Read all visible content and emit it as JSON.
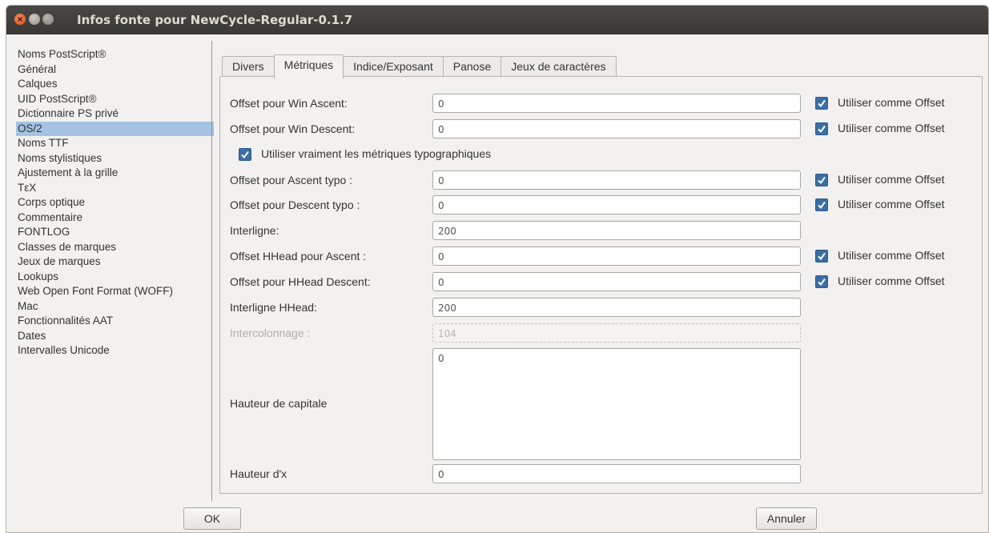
{
  "window": {
    "title": "Infos fonte pour NewCycle-Regular-0.1.7"
  },
  "sidebar": {
    "items": [
      {
        "label": "Noms PostScript®",
        "selected": false
      },
      {
        "label": "Général",
        "selected": false
      },
      {
        "label": "Calques",
        "selected": false
      },
      {
        "label": "UID PostScript®",
        "selected": false
      },
      {
        "label": "Dictionnaire PS privé",
        "selected": false
      },
      {
        "label": "OS/2",
        "selected": true
      },
      {
        "label": "Noms TTF",
        "selected": false
      },
      {
        "label": "Noms stylistiques",
        "selected": false
      },
      {
        "label": "Ajustement à la grille",
        "selected": false
      },
      {
        "label": "TεX",
        "selected": false
      },
      {
        "label": "Corps optique",
        "selected": false
      },
      {
        "label": "Commentaire",
        "selected": false
      },
      {
        "label": "FONTLOG",
        "selected": false
      },
      {
        "label": "Classes de marques",
        "selected": false
      },
      {
        "label": "Jeux de marques",
        "selected": false
      },
      {
        "label": "Lookups",
        "selected": false
      },
      {
        "label": "Web Open Font Format (WOFF)",
        "selected": false
      },
      {
        "label": "Mac",
        "selected": false
      },
      {
        "label": "Fonctionnalités AAT",
        "selected": false
      },
      {
        "label": "Dates",
        "selected": false
      },
      {
        "label": "Intervalles Unicode",
        "selected": false
      }
    ]
  },
  "tabs": [
    {
      "label": "Divers",
      "active": false
    },
    {
      "label": "Métriques",
      "active": true
    },
    {
      "label": "Indice/Exposant",
      "active": false
    },
    {
      "label": "Panose",
      "active": false
    },
    {
      "label": "Jeux de caractères",
      "active": false
    }
  ],
  "metrics": {
    "win_ascent": {
      "label": "Offset pour Win Ascent:",
      "value": "0",
      "offset_label": "Utiliser comme Offset",
      "offset_checked": true
    },
    "win_descent": {
      "label": "Offset pour Win Descent:",
      "value": "0",
      "offset_label": "Utiliser comme Offset",
      "offset_checked": true
    },
    "typo_metrics": {
      "label": "Utiliser vraiment les métriques typographiques",
      "checked": true
    },
    "typo_ascent": {
      "label": "Offset pour Ascent typo :",
      "value": "0",
      "offset_label": "Utiliser comme Offset",
      "offset_checked": true
    },
    "typo_descent": {
      "label": "Offset pour Descent typo :",
      "value": "0",
      "offset_label": "Utiliser comme Offset",
      "offset_checked": true
    },
    "line_gap": {
      "label": "Interligne:",
      "value": "200"
    },
    "hhead_ascent": {
      "label": "Offset HHead pour Ascent :",
      "value": "0",
      "offset_label": "Utiliser comme Offset",
      "offset_checked": true
    },
    "hhead_descent": {
      "label": "Offset pour HHead Descent:",
      "value": "0",
      "offset_label": "Utiliser comme Offset",
      "offset_checked": true
    },
    "hhead_line_gap": {
      "label": "Interligne HHead:",
      "value": "200"
    },
    "vertical_line_gap": {
      "label": "Intercolonnage :",
      "value": "104",
      "disabled": true
    },
    "cap_height": {
      "label": "Hauteur de capitale",
      "value": "0"
    },
    "x_height": {
      "label": "Hauteur d'x",
      "value": "0"
    }
  },
  "buttons": {
    "ok": "OK",
    "cancel": "Annuler"
  },
  "colors": {
    "selection": "#a5c2e2",
    "checkbox": "#3a6ea5",
    "titlebar": "#3c3b37",
    "close": "#df4a16"
  }
}
